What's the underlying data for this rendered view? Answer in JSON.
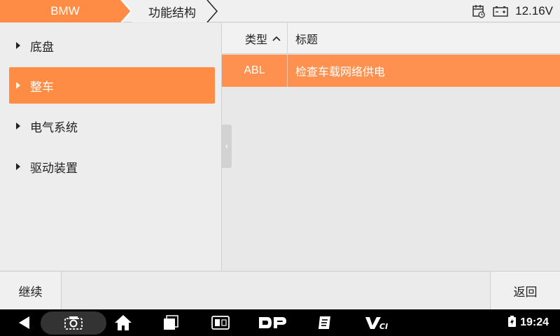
{
  "header": {
    "breadcrumb": [
      "BMW",
      "功能结构"
    ],
    "voltage": "12.16V",
    "accent_color": "#ff8c45"
  },
  "sidebar": {
    "items": [
      {
        "label": "底盘",
        "active": false
      },
      {
        "label": "整车",
        "active": true
      },
      {
        "label": "电气系统",
        "active": false
      },
      {
        "label": "驱动装置",
        "active": false
      }
    ]
  },
  "table": {
    "columns": {
      "type": "类型",
      "title": "标题"
    },
    "rows": [
      {
        "type": "ABL",
        "title": "检查车载网络供电",
        "selected": true
      }
    ]
  },
  "actions": {
    "continue_label": "继续",
    "back_label": "返回"
  },
  "system_bar": {
    "time": "19:24",
    "icons": [
      "back-icon",
      "screenshot-icon",
      "home-icon",
      "recents-icon",
      "vci-card-icon",
      "dp-icon",
      "report-icon",
      "vci-icon",
      "wifi-icon",
      "battery-icon"
    ]
  }
}
